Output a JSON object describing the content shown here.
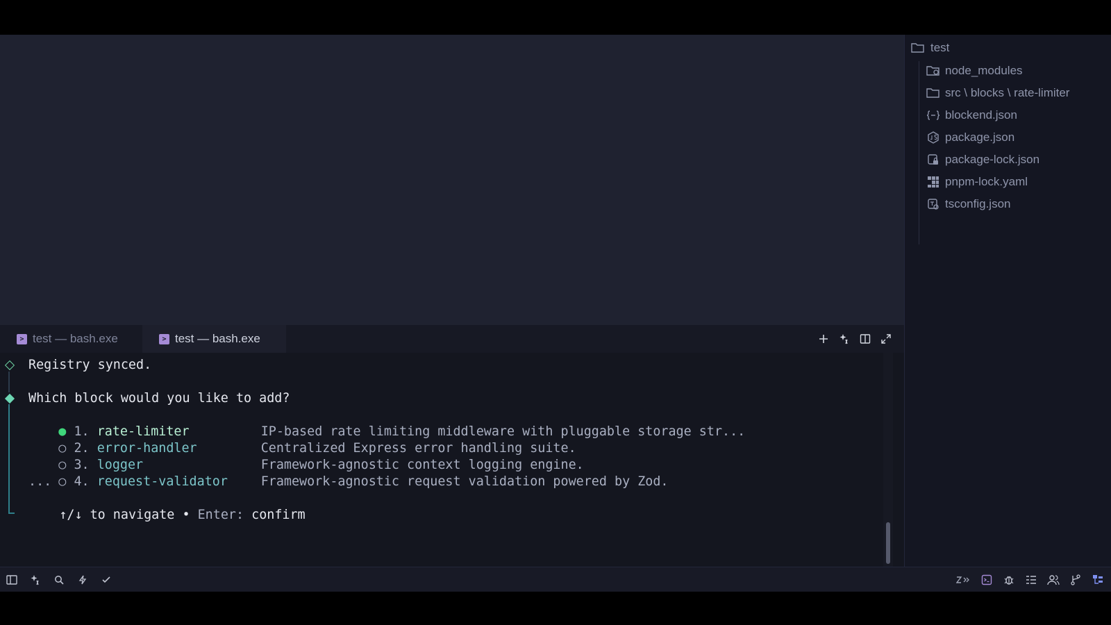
{
  "explorer": {
    "root": "test",
    "items": [
      {
        "label": "node_modules",
        "icon": "folder-settings-icon"
      },
      {
        "label": "src \\ blocks \\ rate-limiter",
        "icon": "folder-icon"
      },
      {
        "label": "blockend.json",
        "icon": "json-braces-icon"
      },
      {
        "label": "package.json",
        "icon": "nodejs-icon"
      },
      {
        "label": "package-lock.json",
        "icon": "lock-file-icon"
      },
      {
        "label": "pnpm-lock.yaml",
        "icon": "pnpm-icon"
      },
      {
        "label": "tsconfig.json",
        "icon": "tsconfig-icon"
      }
    ]
  },
  "terminal_tabs": [
    {
      "label": "test — bash.exe",
      "active": false
    },
    {
      "label": "test — bash.exe",
      "active": true
    }
  ],
  "terminal": {
    "synced": "Registry synced.",
    "question": "Which block would you like to add?",
    "options": [
      {
        "num": "1.",
        "name": "rate-limiter",
        "desc": "IP-based rate limiting middleware with pluggable storage str...",
        "selected": true
      },
      {
        "num": "2.",
        "name": "error-handler",
        "desc": "Centralized Express error handling suite.",
        "selected": false
      },
      {
        "num": "3.",
        "name": "logger",
        "desc": "Framework-agnostic context logging engine.",
        "selected": false
      },
      {
        "num": "4.",
        "name": "request-validator",
        "desc": "Framework-agnostic request validation powered by Zod.",
        "selected": false
      }
    ],
    "ellipsis": "...",
    "hint_keys": "↑/↓",
    "hint_nav": " to navigate • ",
    "hint_enter": "Enter: ",
    "hint_confirm": "confirm"
  },
  "colors": {
    "accent_green": "#3fd67b",
    "accent_teal": "#7cc5c9",
    "terminal_icon": "#a58bd6"
  }
}
